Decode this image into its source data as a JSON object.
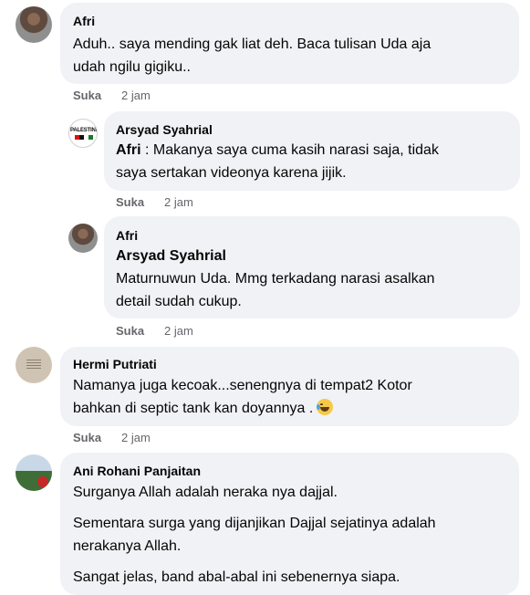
{
  "comments": [
    {
      "author": "Afri",
      "mention": "",
      "lines": [
        "Aduh.. saya mending gak liat deh. Baca tulisan Uda aja",
        "udah ngilu gigiku.."
      ],
      "like_label": "Suka",
      "time": "2 jam"
    },
    {
      "author": "Arsyad Syahrial",
      "avatar_text": "PALESTINE",
      "mention": "Afri",
      "lines": [
        " : Makanya saya cuma kasih narasi saja, tidak",
        "saya sertakan videonya karena jijik."
      ],
      "like_label": "Suka",
      "time": "2 jam"
    },
    {
      "author": "Afri",
      "mention": "Arsyad Syahrial",
      "lines": [
        "Maturnuwun Uda. Mmg terkadang narasi asalkan",
        "detail sudah cukup."
      ],
      "like_label": "Suka",
      "time": "2 jam"
    },
    {
      "author": "Hermi Putriati",
      "mention": "",
      "lines": [
        "Namanya juga kecoak...senengnya di tempat2 Kotor",
        "bahkan di septic tank kan doyannya ."
      ],
      "emoji": "face-with-tears-of-joy-icon",
      "like_label": "Suka",
      "time": "2 jam"
    },
    {
      "author": "Ani Rohani Panjaitan",
      "mention": "",
      "lines": [
        "Surganya Allah adalah neraka nya dajjal.",
        "Sementara surga yang dijanjikan Dajjal sejatinya adalah",
        "nerakanya Allah.",
        "Sangat jelas, band abal-abal ini sebenernya siapa."
      ]
    }
  ],
  "colors": {
    "bubble": "#f0f2f5",
    "secondary_text": "#65676b",
    "primary_text": "#050505"
  }
}
